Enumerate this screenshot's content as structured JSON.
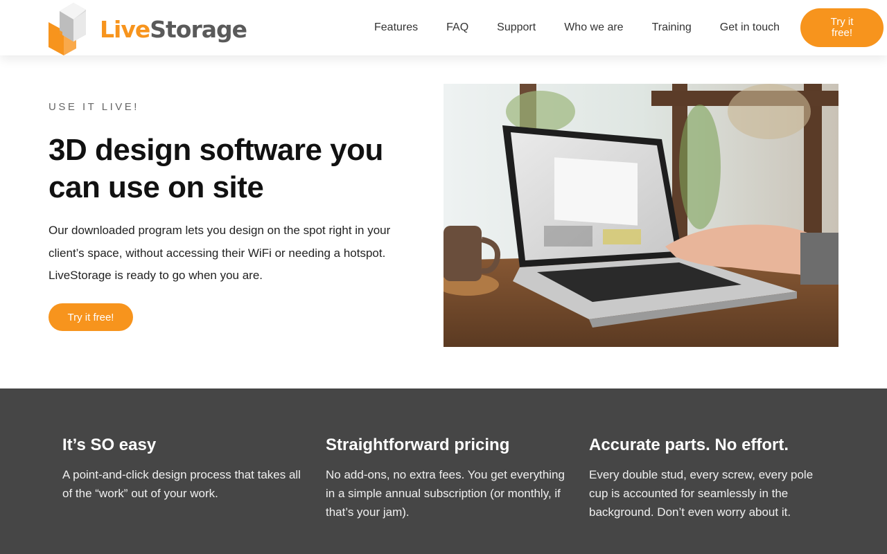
{
  "brand": {
    "name_part1": "Live",
    "name_part2": "Storage",
    "logo_icon": "cube-logo-icon",
    "accent_color": "#f7941d",
    "text_gray": "#5a5a5a"
  },
  "nav": {
    "items": [
      {
        "label": "Features"
      },
      {
        "label": "FAQ"
      },
      {
        "label": "Support"
      },
      {
        "label": "Who we are"
      },
      {
        "label": "Training"
      },
      {
        "label": "Get in touch"
      }
    ],
    "cta_label": "Try it free!"
  },
  "hero": {
    "eyebrow": "USE IT LIVE!",
    "title": "3D design software you can use on site",
    "body": "Our downloaded program lets you design on the spot right in your client’s space, without accessing their WiFi or needing a hotspot. LiveStorage is ready to go when you are.",
    "button_label": "Try it free!",
    "image_subject": "laptop-on-wooden-table-photo"
  },
  "features": {
    "background": "#464646",
    "items": [
      {
        "title": "It’s SO easy",
        "body": "A point-and-click design process that takes all of the “work” out of your work."
      },
      {
        "title": "Straightforward pricing",
        "body": "No add-ons, no extra fees. You get everything in a simple annual subscription (or monthly, if that’s your jam)."
      },
      {
        "title": "Accurate parts. No effort.",
        "body": "Every double stud, every screw, every pole cup is accounted for seamlessly in the background. Don’t even worry about it."
      }
    ]
  }
}
